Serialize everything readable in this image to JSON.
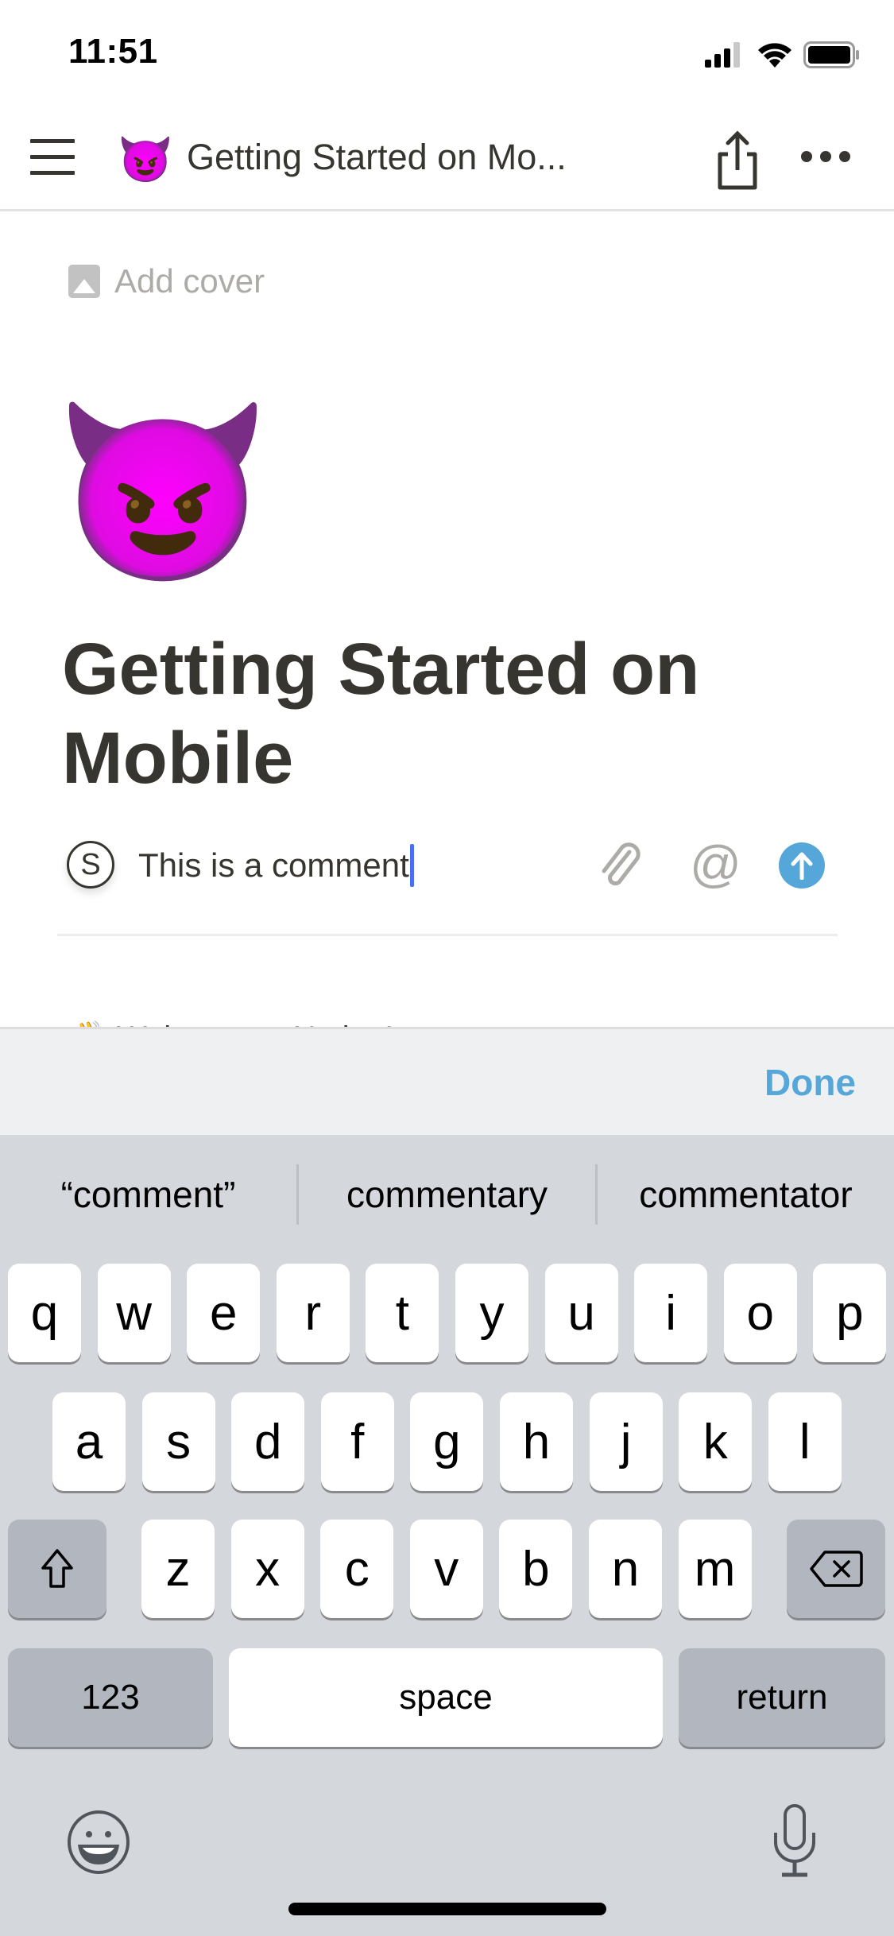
{
  "status_bar": {
    "time": "11:51",
    "icons": [
      "signal-icon",
      "wifi-icon",
      "battery-icon"
    ]
  },
  "header": {
    "menu_icon": "hamburger-icon",
    "page_emoji": "😈",
    "title": "Getting Started on Mo...",
    "share_icon": "share-icon",
    "more_icon": "more-icon"
  },
  "page": {
    "add_cover_label": "Add cover",
    "icon_emoji": "😈",
    "title": "Getting Started on Mobile",
    "partial_block_emoji": "👋",
    "partial_block_text": "Welcome to Notion!"
  },
  "comment": {
    "avatar_initial": "S",
    "value": "This is a comment",
    "attach_icon": "paperclip-icon",
    "mention_symbol": "@",
    "send_icon": "arrow-up-icon"
  },
  "keyboard_accessory": {
    "done_label": "Done"
  },
  "keyboard": {
    "suggestions": [
      "“comment”",
      "commentary",
      "commentator"
    ],
    "row1": [
      "q",
      "w",
      "e",
      "r",
      "t",
      "y",
      "u",
      "i",
      "o",
      "p"
    ],
    "row2": [
      "a",
      "s",
      "d",
      "f",
      "g",
      "h",
      "j",
      "k",
      "l"
    ],
    "row3": [
      "z",
      "x",
      "c",
      "v",
      "b",
      "n",
      "m"
    ],
    "numbers_label": "123",
    "space_label": "space",
    "return_label": "return"
  },
  "colors": {
    "accent": "#55a6d9",
    "caret": "#4a6cf7",
    "text": "#37352f",
    "muted": "#acaba8",
    "keyboard_bg": "#d4d7dc"
  }
}
